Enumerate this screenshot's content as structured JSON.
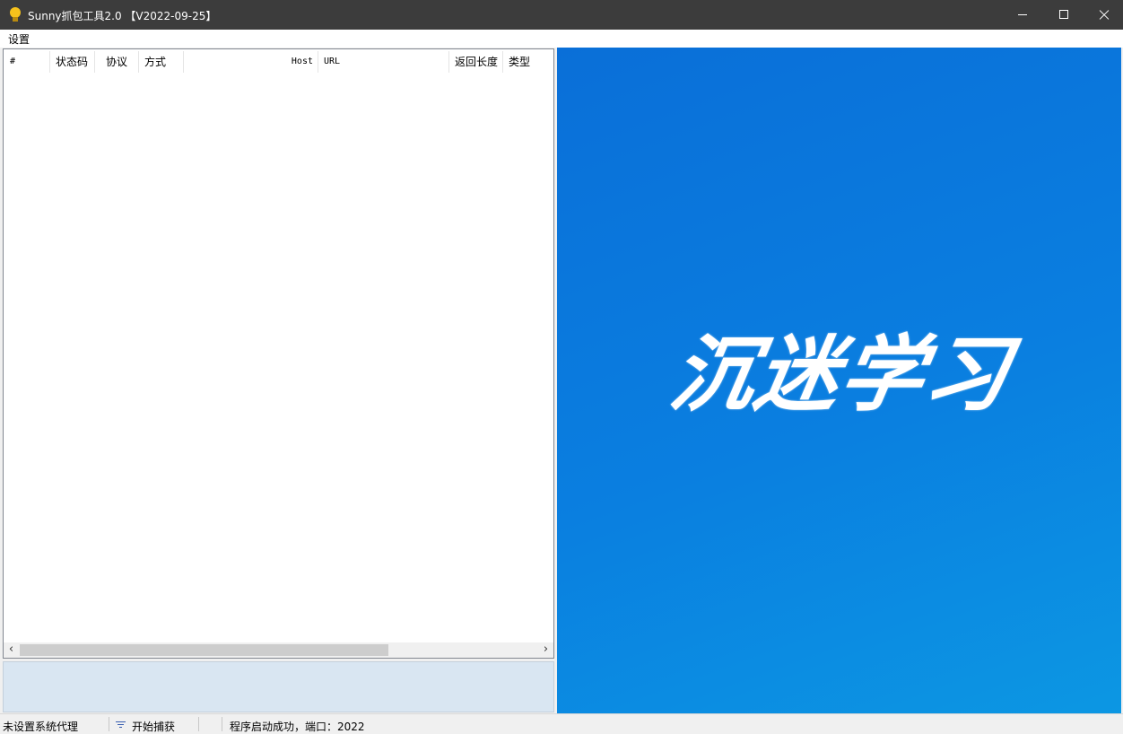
{
  "window": {
    "title": "Sunny抓包工具2.0 【V2022-09-25】",
    "icon": "lightbulb-icon",
    "controls": [
      "minimize-icon",
      "maximize-icon",
      "close-icon"
    ]
  },
  "menu": {
    "items": [
      "设置"
    ]
  },
  "table": {
    "columns": [
      "#",
      "状态码",
      "协议",
      "方式",
      "Host",
      "URL",
      "返回长度",
      "类型"
    ],
    "rows": []
  },
  "banner": {
    "text": "沉迷学习",
    "color_start": "#0a6fd8",
    "color_end": "#0c97e3"
  },
  "status": {
    "proxy": "未设置系统代理",
    "capture_label": "开始捕获",
    "capture_icon": "filter-icon",
    "message": "程序启动成功，端口：2022"
  }
}
